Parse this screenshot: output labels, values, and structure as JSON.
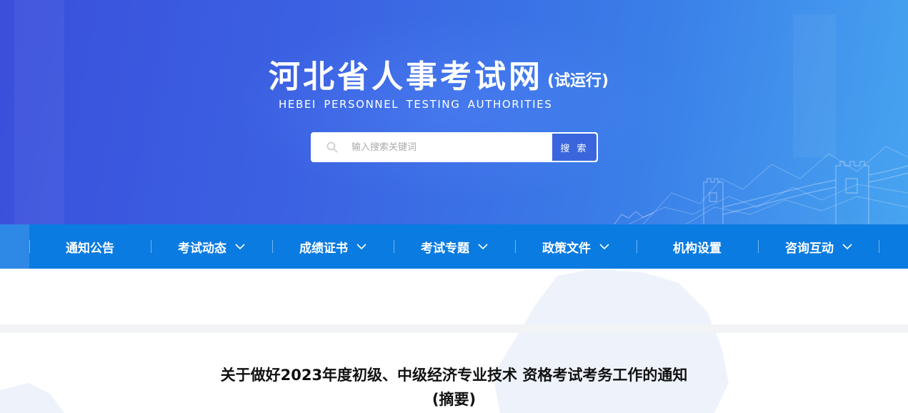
{
  "header": {
    "site_title": "河北省人事考试网",
    "trial_label": "(试运行)",
    "subtitle": "HEBEI PERSONNEL TESTING AUTHORITIES",
    "search": {
      "placeholder": "输入搜索关键词",
      "button_label": "搜 索",
      "icon": "search-icon"
    }
  },
  "nav": {
    "items": [
      {
        "label": "通知公告",
        "has_dropdown": false
      },
      {
        "label": "考试动态",
        "has_dropdown": true
      },
      {
        "label": "成绩证书",
        "has_dropdown": true
      },
      {
        "label": "考试专题",
        "has_dropdown": true
      },
      {
        "label": "政策文件",
        "has_dropdown": true
      },
      {
        "label": "机构设置",
        "has_dropdown": false
      },
      {
        "label": "咨询互动",
        "has_dropdown": true
      }
    ]
  },
  "article": {
    "title_line1": "关于做好2023年度初级、中级经济专业技术 资格考试考务工作的通知",
    "title_line2": "(摘要)"
  },
  "colors": {
    "banner_start": "#3a4fdc",
    "banner_end": "#47a4f0",
    "nav_bg": "#0a7be0",
    "search_button": "#3a66dd"
  }
}
